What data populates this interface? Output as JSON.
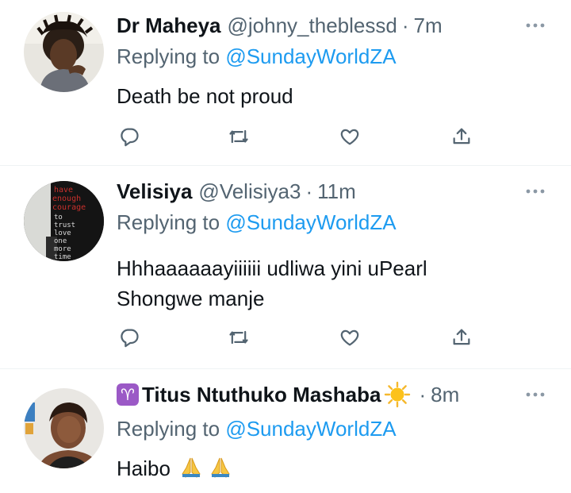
{
  "tweets": [
    {
      "display_name": "Dr Maheya",
      "handle": "@johny_theblessd",
      "separator": "·",
      "time": "7m",
      "replying_prefix": "Replying to",
      "replying_to": "@SundayWorldZA",
      "body_lines": [
        "Death be not proud"
      ]
    },
    {
      "display_name": "Velisiya",
      "handle": "@Velisiya3",
      "separator": "·",
      "time": "11m",
      "replying_prefix": "Replying to",
      "replying_to": "@SundayWorldZA",
      "body_lines": [
        "Hhhaaaaaayiiiiii udliwa yini uPearl",
        "Shongwe manje"
      ],
      "avatar_text": [
        "have",
        "enough",
        "courage",
        "to",
        "trust",
        "love",
        "one",
        "more",
        "time"
      ]
    },
    {
      "display_name": "Titus Ntuthuko Mashaba",
      "handle": "",
      "separator": "·",
      "time": "8m",
      "replying_prefix": "Replying to",
      "replying_to": "@SundayWorldZA",
      "body_text": "Haibo",
      "name_prefix_emoji": "aries-zodiac-badge",
      "name_suffix_emoji": "sun-emoji",
      "body_emojis": [
        "folded-hands-emoji",
        "folded-hands-emoji"
      ]
    }
  ],
  "icons": {
    "more": "more-horizontal-icon",
    "reply": "reply-icon",
    "retweet": "retweet-icon",
    "like": "like-icon",
    "share": "share-icon"
  },
  "colors": {
    "text": "#0f1419",
    "secondary": "#536471",
    "link": "#1d9bf0",
    "divider": "#eff3f4"
  }
}
